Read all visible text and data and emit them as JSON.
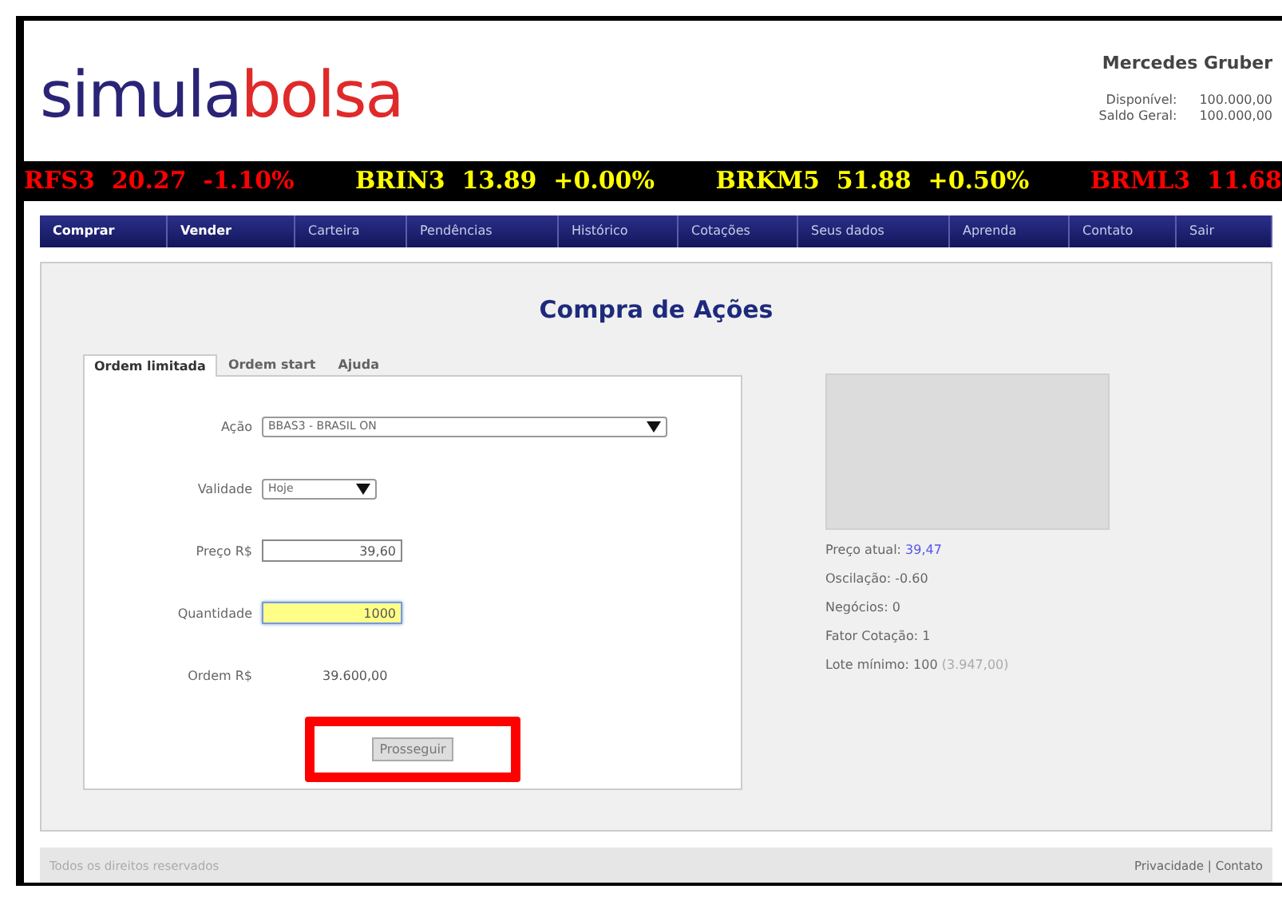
{
  "header": {
    "logo": {
      "first": "simula",
      "second": "bolsa"
    },
    "user_name": "Mercedes Gruber",
    "balances": [
      {
        "label": "Disponível:",
        "value": "100.000,00"
      },
      {
        "label": "Saldo Geral:",
        "value": "100.000,00"
      }
    ]
  },
  "ticker": [
    {
      "text": "RFS3  20.27  -1.10%",
      "color": "#ff0000"
    },
    {
      "text": "BRIN3  13.89  +0.00%",
      "color": "#ffff00"
    },
    {
      "text": "BRKM5  51.88  +0.50%",
      "color": "#ffff00"
    },
    {
      "text": "BRML3  11.68",
      "color": "#ff0000"
    }
  ],
  "nav": [
    {
      "label": "Comprar",
      "selected": true
    },
    {
      "label": "Vender",
      "selected": true
    },
    {
      "label": "Carteira",
      "selected": false
    },
    {
      "label": "Pendências",
      "selected": false
    },
    {
      "label": "Histórico",
      "selected": false
    },
    {
      "label": "Cotações",
      "selected": false
    },
    {
      "label": "Seus dados",
      "selected": false
    },
    {
      "label": "Aprenda",
      "selected": false
    },
    {
      "label": "Contato",
      "selected": false
    },
    {
      "label": "Sair",
      "selected": false
    }
  ],
  "page_title": "Compra de Ações",
  "tabs": [
    {
      "label": "Ordem limitada",
      "selected": true
    },
    {
      "label": "Ordem start",
      "selected": false
    },
    {
      "label": "Ajuda",
      "selected": false
    }
  ],
  "form": [
    {
      "kind": "select",
      "label": "Ação",
      "value": "BBAS3 - BRASIL ON"
    },
    {
      "kind": "selectsmall",
      "label": "Validade",
      "value": "Hoje"
    },
    {
      "kind": "input",
      "label": "Preço R$",
      "value": "39,60",
      "focused": false
    },
    {
      "kind": "input",
      "label": "Quantidade",
      "value": "1000",
      "focused": true
    },
    {
      "kind": "text",
      "label": "Ordem R$",
      "value": "39.600,00"
    }
  ],
  "submit": {
    "label": "Prosseguir",
    "highlighted": true
  },
  "quote": [
    {
      "label": "Preço atual:",
      "value": "39,47",
      "kind": "link"
    },
    {
      "label": "Oscilação:",
      "value": "-0.60",
      "kind": "plain"
    },
    {
      "label": "Negócios:",
      "value": "0",
      "kind": "plain"
    },
    {
      "label": "Fator Cotação:",
      "value": "1",
      "kind": "plain"
    },
    {
      "label": "Lote mínimo:",
      "value": "100",
      "extra": "(3.947,00)",
      "kind": "plain"
    }
  ],
  "footer": {
    "copyright": "Todos os direitos reservados",
    "links": [
      "Privacidade",
      "Contato"
    ],
    "separator": "|"
  }
}
